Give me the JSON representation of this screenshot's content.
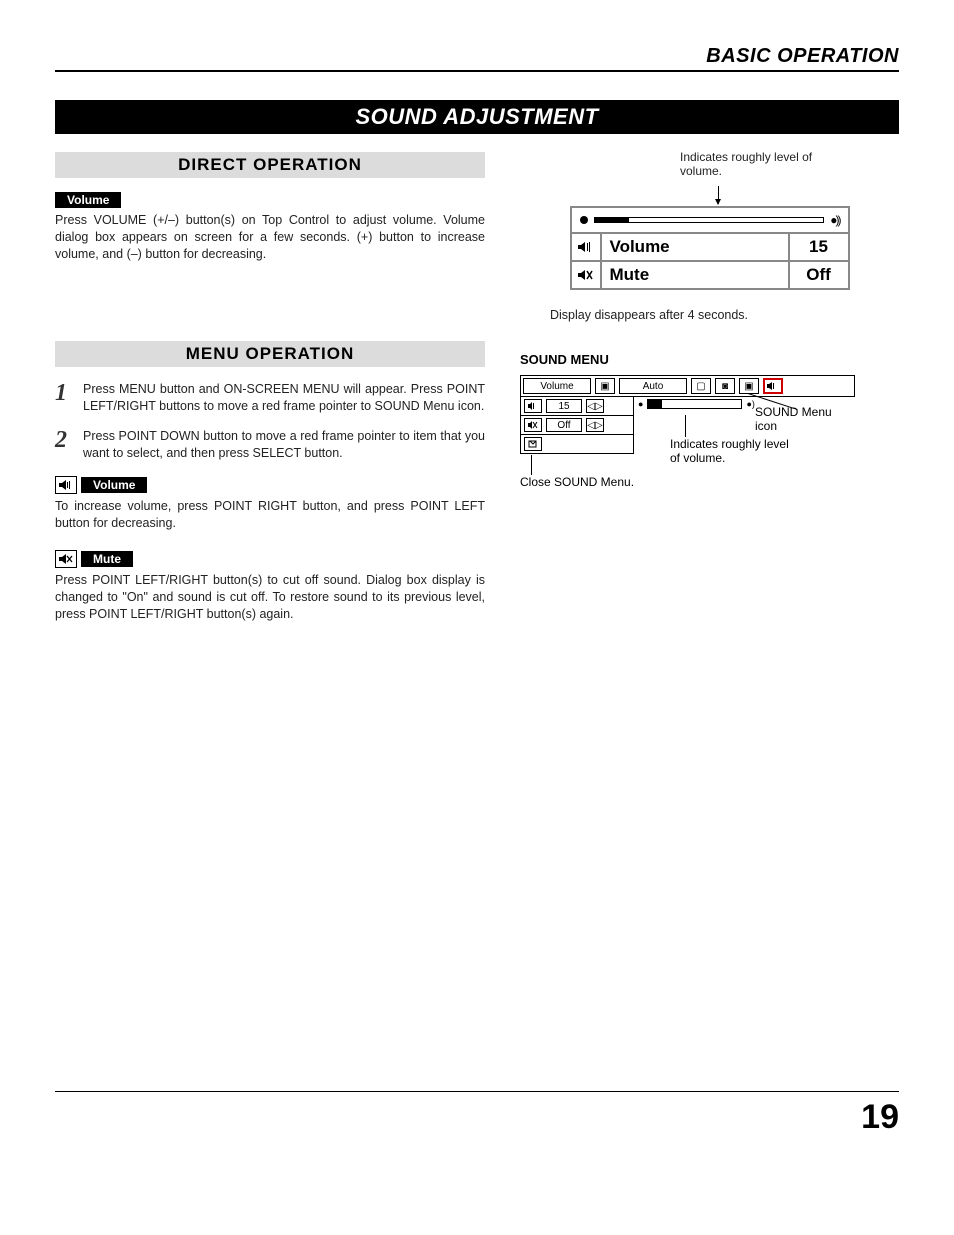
{
  "header": {
    "section": "BASIC OPERATION"
  },
  "title": "SOUND ADJUSTMENT",
  "direct": {
    "heading": "DIRECT OPERATION",
    "volume_tag": "Volume",
    "volume_text": "Press VOLUME (+/–) button(s) on Top Control to adjust volume. Volume dialog box appears on screen for a few seconds. (+) button to increase volume, and (–) button for decreasing."
  },
  "menu": {
    "heading": "MENU OPERATION",
    "step1": "Press MENU button and ON-SCREEN MENU will appear.  Press POINT LEFT/RIGHT buttons to move a red frame pointer to SOUND Menu icon.",
    "step2": "Press POINT DOWN button to move a red frame pointer to item that you want to select, and then press SELECT button.",
    "volume_tag": "Volume",
    "volume_text": "To increase volume, press POINT RIGHT button, and press POINT LEFT button for decreasing.",
    "mute_tag": "Mute",
    "mute_text": "Press POINT LEFT/RIGHT button(s) to cut off sound.  Dialog box display is changed to \"On\" and sound is cut off.  To restore sound to its previous level, press POINT LEFT/RIGHT button(s) again."
  },
  "osd": {
    "annotation_top": "Indicates roughly level of volume.",
    "volume_label": "Volume",
    "volume_value": "15",
    "mute_label": "Mute",
    "mute_value": "Off",
    "note_below": "Display disappears after 4 seconds."
  },
  "sound_menu": {
    "title": "SOUND MENU",
    "topbar_label": "Volume",
    "topbar_mode": "Auto",
    "row_volume_value": "15",
    "row_mute_value": "Off",
    "callout_icon": "SOUND Menu icon",
    "callout_bar": "Indicates roughly level of volume.",
    "callout_close": "Close SOUND Menu."
  },
  "page": "19"
}
